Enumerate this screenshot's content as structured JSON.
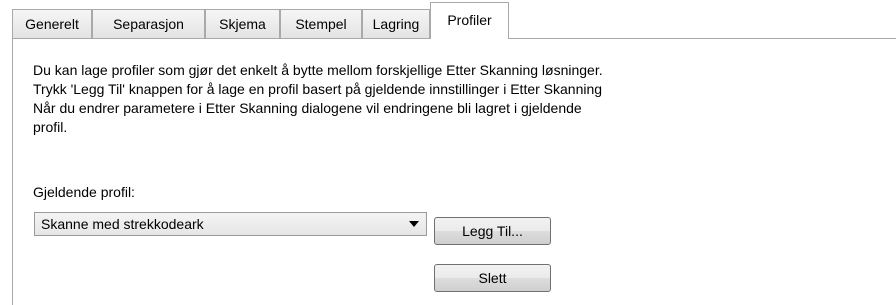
{
  "tabs": [
    {
      "label": "Generelt",
      "active": false
    },
    {
      "label": "Separasjon",
      "active": false
    },
    {
      "label": "Skjema",
      "active": false
    },
    {
      "label": "Stempel",
      "active": false
    },
    {
      "label": "Lagring",
      "active": false
    },
    {
      "label": "Profiler",
      "active": true
    }
  ],
  "description_lines": [
    "Du kan lage profiler som gjør det enkelt å bytte mellom forskjellige Etter Skanning løsninger.",
    "Trykk 'Legg Til' knappen for å lage en profil basert på gjeldende innstillinger i Etter Skanning",
    "Når du endrer parametere i Etter Skanning dialogene vil endringene bli lagret i gjeldende",
    "profil."
  ],
  "profile": {
    "label": "Gjeldende profil:",
    "selected": "Skanne med strekkodeark",
    "dropdown_icon": "chevron-down-icon"
  },
  "buttons": {
    "add_label": "Legg Til...",
    "delete_label": "Slett"
  }
}
